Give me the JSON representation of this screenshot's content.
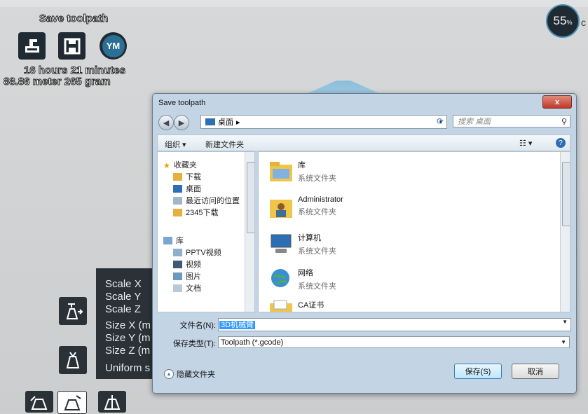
{
  "app": {
    "save_title": "Save toolpath",
    "print_time": "16 hours 21 minutes",
    "material": "88.86 meter 265 gram",
    "ym_label": "YM",
    "progress_value": "55",
    "progress_unit": "%",
    "edge_char": "c"
  },
  "scale_panel": {
    "rows": [
      "Scale X",
      "Scale Y",
      "Scale Z",
      "Size X (m",
      "Size Y (m",
      "Size Z (m",
      "Uniform s"
    ]
  },
  "dialog": {
    "title": "Save toolpath",
    "close_label": "x",
    "address_path": "桌面",
    "search_placeholder": "搜索 桌面",
    "toolbar": {
      "organize": "组织 ▾",
      "new_folder": "新建文件夹",
      "help": "?"
    },
    "nav": {
      "favorites": "收藏夹",
      "favorites_items": [
        "下载",
        "桌面",
        "最近访问的位置",
        "2345下载"
      ],
      "libraries": "库",
      "library_items": [
        "PPTV视频",
        "视频",
        "图片",
        "文档"
      ]
    },
    "files": [
      {
        "name": "库",
        "type": "系统文件夹"
      },
      {
        "name": "Administrator",
        "type": "系统文件夹"
      },
      {
        "name": "计算机",
        "type": "系统文件夹"
      },
      {
        "name": "网络",
        "type": "系统文件夹"
      },
      {
        "name": "CA证书",
        "type": ""
      }
    ],
    "filename_label": "文件名(N):",
    "filename_value": "3D机械臂",
    "filetype_label": "保存类型(T):",
    "filetype_value": "Toolpath (*.gcode)",
    "hide_folders": "隐藏文件夹",
    "save_button": "保存(S)",
    "cancel_button": "取消"
  },
  "colors": {
    "panel": "#2a3137",
    "accent": "#2c6fb4",
    "dialog_frame": "#c3d4e5"
  }
}
